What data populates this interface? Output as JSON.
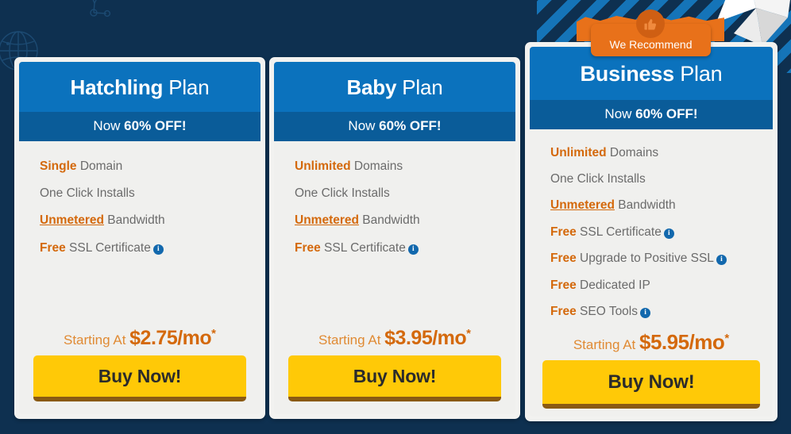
{
  "page": {
    "background_color": "#0e3050",
    "accent_blue": "#0b72bd",
    "promo_blue": "#0a5c99",
    "highlight_orange": "#d4690c",
    "button_yellow": "#ffc907",
    "badge_orange": "#e8711a"
  },
  "recommend_badge": {
    "label": "We Recommend",
    "icon": "thumbs-up-icon"
  },
  "plans": [
    {
      "id": "hatchling",
      "name_bold": "Hatchling",
      "name_light": "Plan",
      "promo_prefix": "Now ",
      "promo_bold": "60% OFF!",
      "features": [
        {
          "highlight": "Single",
          "underline": false,
          "text": " Domain",
          "info": false
        },
        {
          "highlight": "",
          "underline": false,
          "text": "One Click Installs",
          "info": false
        },
        {
          "highlight": "Unmetered",
          "underline": true,
          "text": " Bandwidth",
          "info": false
        },
        {
          "highlight": "Free",
          "underline": false,
          "text": " SSL Certificate",
          "info": true
        }
      ],
      "price_prefix": "Starting At ",
      "price": "$2.75/mo",
      "price_star": "*",
      "buy_label": "Buy Now!"
    },
    {
      "id": "baby",
      "name_bold": "Baby",
      "name_light": "Plan",
      "promo_prefix": "Now ",
      "promo_bold": "60% OFF!",
      "features": [
        {
          "highlight": "Unlimited",
          "underline": false,
          "text": " Domains",
          "info": false
        },
        {
          "highlight": "",
          "underline": false,
          "text": "One Click Installs",
          "info": false
        },
        {
          "highlight": "Unmetered",
          "underline": true,
          "text": " Bandwidth",
          "info": false
        },
        {
          "highlight": "Free",
          "underline": false,
          "text": " SSL Certificate",
          "info": true
        }
      ],
      "price_prefix": "Starting At ",
      "price": "$3.95/mo",
      "price_star": "*",
      "buy_label": "Buy Now!"
    },
    {
      "id": "business",
      "name_bold": "Business",
      "name_light": "Plan",
      "promo_prefix": "Now ",
      "promo_bold": "60% OFF!",
      "features": [
        {
          "highlight": "Unlimited",
          "underline": false,
          "text": " Domains",
          "info": false
        },
        {
          "highlight": "",
          "underline": false,
          "text": "One Click Installs",
          "info": false
        },
        {
          "highlight": "Unmetered",
          "underline": true,
          "text": " Bandwidth",
          "info": false
        },
        {
          "highlight": "Free",
          "underline": false,
          "text": " SSL Certificate",
          "info": true
        },
        {
          "highlight": "Free",
          "underline": false,
          "text": " Upgrade to Positive SSL",
          "info": true
        },
        {
          "highlight": "Free",
          "underline": false,
          "text": " Dedicated IP",
          "info": false
        },
        {
          "highlight": "Free",
          "underline": false,
          "text": " SEO Tools",
          "info": true
        }
      ],
      "price_prefix": "Starting At ",
      "price": "$5.95/mo",
      "price_star": "*",
      "buy_label": "Buy Now!"
    }
  ],
  "decorations": [
    {
      "name": "globe-icon"
    },
    {
      "name": "network-nodes-icon"
    },
    {
      "name": "diagonal-stripes"
    },
    {
      "name": "origami-shape"
    }
  ]
}
